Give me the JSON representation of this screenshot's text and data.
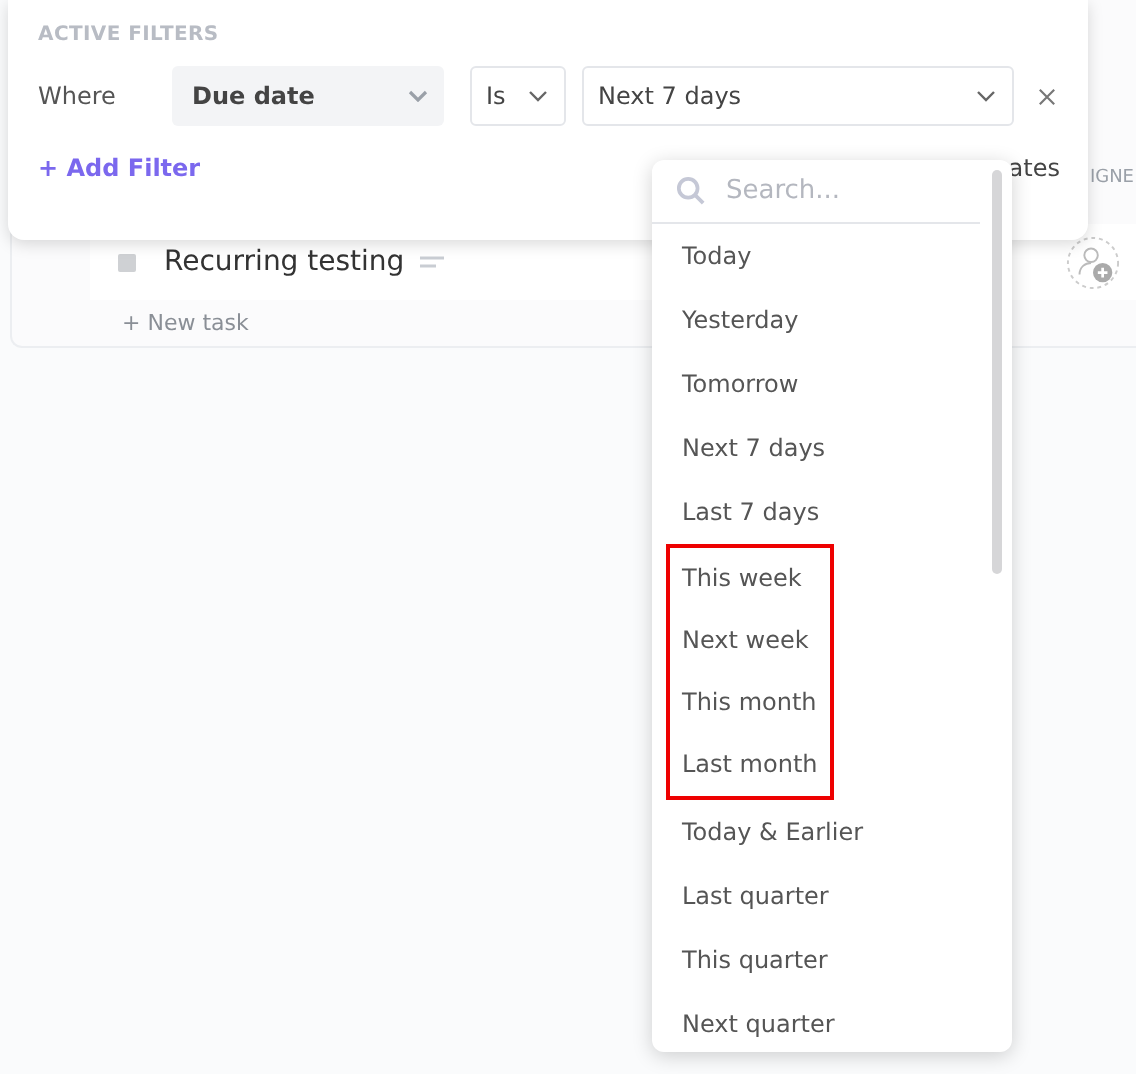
{
  "task_list": {
    "column_header": "IGNE",
    "tasks": [
      {
        "name": "Recurring testing"
      }
    ],
    "new_task": "+ New task"
  },
  "filter_panel": {
    "title": "ACTIVE FILTERS",
    "where_label": "Where",
    "field": "Due date",
    "operator": "Is",
    "value": "Next 7 days",
    "add_filter": "+ Add Filter",
    "templates": "ates"
  },
  "dropdown": {
    "search": {
      "placeholder": "Search..."
    },
    "options": [
      {
        "label": "Today",
        "highlighted": false
      },
      {
        "label": "Yesterday",
        "highlighted": false
      },
      {
        "label": "Tomorrow",
        "highlighted": false
      },
      {
        "label": "Next 7 days",
        "highlighted": false
      },
      {
        "label": "Last 7 days",
        "highlighted": false
      },
      {
        "label": "This week",
        "highlighted": true
      },
      {
        "label": "Next week",
        "highlighted": true
      },
      {
        "label": "This month",
        "highlighted": true
      },
      {
        "label": "Last month",
        "highlighted": true
      },
      {
        "label": "Today & Earlier",
        "highlighted": false
      },
      {
        "label": "Last quarter",
        "highlighted": false
      },
      {
        "label": "This quarter",
        "highlighted": false
      },
      {
        "label": "Next quarter",
        "highlighted": false
      }
    ]
  }
}
